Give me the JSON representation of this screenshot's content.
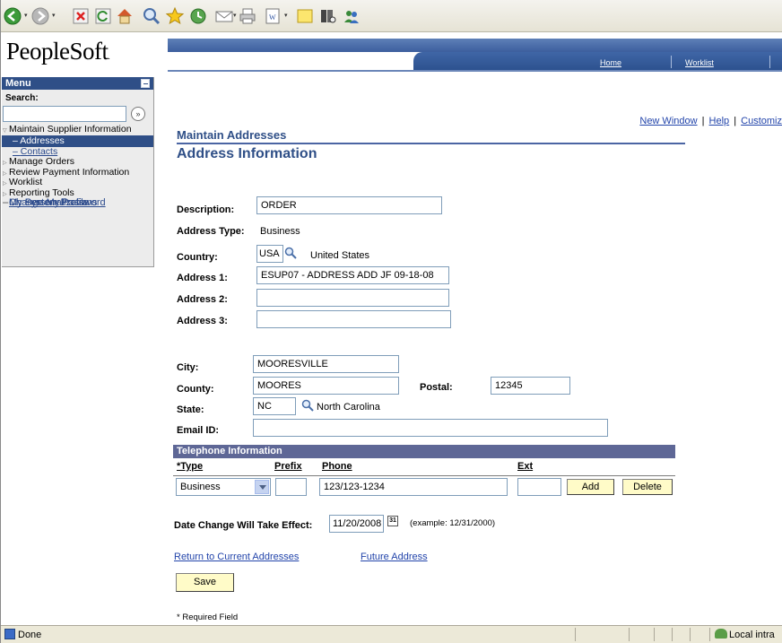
{
  "colors": {
    "menu_header": "#2f4f87",
    "heading_blue": "#2f4f87",
    "link_blue": "#2244aa",
    "tel_header": "#5e6796",
    "button_bg": "#fffbc8"
  },
  "toolbar": {
    "icons": [
      "back-icon",
      "forward-icon",
      "stop-icon",
      "refresh-icon",
      "home-icon",
      "search-icon",
      "favorites-icon",
      "history-icon",
      "mail-icon",
      "print-icon",
      "word-icon",
      "discuss-icon",
      "research-icon",
      "messenger-icon"
    ]
  },
  "header": {
    "logo": "PeopleSoft",
    "logo_mark": ".",
    "nav": {
      "home": "Home",
      "worklist": "Worklist"
    }
  },
  "menu": {
    "title": "Menu",
    "search_label": "Search:",
    "search_go": "»",
    "items": [
      {
        "label": "Maintain Supplier Information",
        "kind": "open"
      },
      {
        "label": "Addresses",
        "kind": "selected"
      },
      {
        "label": "Contacts",
        "kind": "sub"
      },
      {
        "label": "Manage Orders",
        "kind": "folder"
      },
      {
        "label": "Review Payment Information",
        "kind": "folder"
      },
      {
        "label": "Worklist",
        "kind": "folder"
      },
      {
        "label": "Reporting Tools",
        "kind": "folder"
      },
      {
        "label": "Change My Password",
        "kind": "link"
      },
      {
        "label": "My Personalizations",
        "kind": "link"
      },
      {
        "label": "My System Profile",
        "kind": "link"
      }
    ]
  },
  "toplinks": {
    "new_window": "New Window",
    "help": "Help",
    "customize": "Customiz",
    "separator": "|"
  },
  "page": {
    "subtitle": "Maintain Addresses",
    "title": "Address Information"
  },
  "form": {
    "description": {
      "label": "Description:",
      "value": "ORDER"
    },
    "address_type": {
      "label": "Address Type:",
      "value": "Business"
    },
    "country": {
      "label": "Country:",
      "code": "USA",
      "name": "United States"
    },
    "address1": {
      "label": "Address 1:",
      "value": "ESUP07 - ADDRESS ADD JF 09-18-08"
    },
    "address2": {
      "label": "Address 2:",
      "value": ""
    },
    "address3": {
      "label": "Address 3:",
      "value": ""
    },
    "city": {
      "label": "City:",
      "value": "MOORESVILLE"
    },
    "county": {
      "label": "County:",
      "value": "MOORES"
    },
    "postal": {
      "label": "Postal:",
      "value": "12345"
    },
    "state": {
      "label": "State:",
      "code": "NC",
      "name": "North Carolina"
    },
    "email": {
      "label": "Email ID:",
      "value": ""
    }
  },
  "telephone": {
    "header": "Telephone Information",
    "columns": {
      "type": "*Type",
      "prefix": "Prefix",
      "phone": "Phone",
      "ext": "Ext"
    },
    "rows": [
      {
        "type": "Business",
        "prefix": "",
        "phone": "123/123-1234",
        "ext": ""
      }
    ],
    "add_label": "Add",
    "delete_label": "Delete"
  },
  "effective": {
    "label": "Date Change Will Take Effect:",
    "date": "11/20/2008",
    "calendar_glyph": "31",
    "example": "(example: 12/31/2000)"
  },
  "links": {
    "return": "Return to Current Addresses",
    "future": "Future Address"
  },
  "save_label": "Save",
  "required_note": "* Required Field",
  "status": {
    "text": "Done",
    "zone": "Local intra"
  }
}
